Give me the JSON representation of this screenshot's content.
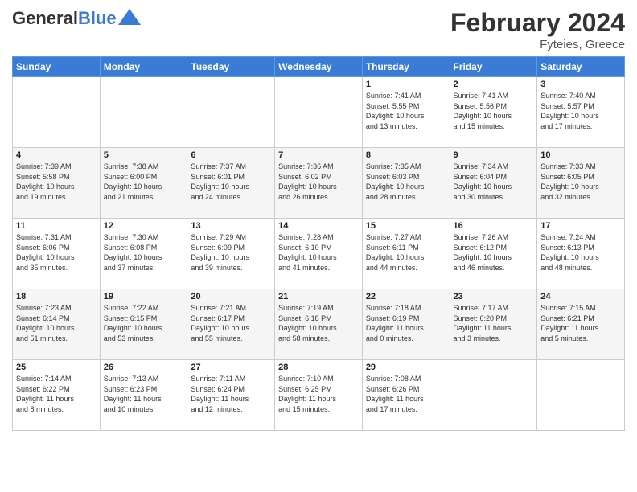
{
  "header": {
    "logo_general": "General",
    "logo_blue": "Blue",
    "title": "February 2024",
    "subtitle": "Fyteies, Greece"
  },
  "days_of_week": [
    "Sunday",
    "Monday",
    "Tuesday",
    "Wednesday",
    "Thursday",
    "Friday",
    "Saturday"
  ],
  "weeks": [
    [
      {
        "day": "",
        "info": ""
      },
      {
        "day": "",
        "info": ""
      },
      {
        "day": "",
        "info": ""
      },
      {
        "day": "",
        "info": ""
      },
      {
        "day": "1",
        "info": "Sunrise: 7:41 AM\nSunset: 5:55 PM\nDaylight: 10 hours\nand 13 minutes."
      },
      {
        "day": "2",
        "info": "Sunrise: 7:41 AM\nSunset: 5:56 PM\nDaylight: 10 hours\nand 15 minutes."
      },
      {
        "day": "3",
        "info": "Sunrise: 7:40 AM\nSunset: 5:57 PM\nDaylight: 10 hours\nand 17 minutes."
      }
    ],
    [
      {
        "day": "4",
        "info": "Sunrise: 7:39 AM\nSunset: 5:58 PM\nDaylight: 10 hours\nand 19 minutes."
      },
      {
        "day": "5",
        "info": "Sunrise: 7:38 AM\nSunset: 6:00 PM\nDaylight: 10 hours\nand 21 minutes."
      },
      {
        "day": "6",
        "info": "Sunrise: 7:37 AM\nSunset: 6:01 PM\nDaylight: 10 hours\nand 24 minutes."
      },
      {
        "day": "7",
        "info": "Sunrise: 7:36 AM\nSunset: 6:02 PM\nDaylight: 10 hours\nand 26 minutes."
      },
      {
        "day": "8",
        "info": "Sunrise: 7:35 AM\nSunset: 6:03 PM\nDaylight: 10 hours\nand 28 minutes."
      },
      {
        "day": "9",
        "info": "Sunrise: 7:34 AM\nSunset: 6:04 PM\nDaylight: 10 hours\nand 30 minutes."
      },
      {
        "day": "10",
        "info": "Sunrise: 7:33 AM\nSunset: 6:05 PM\nDaylight: 10 hours\nand 32 minutes."
      }
    ],
    [
      {
        "day": "11",
        "info": "Sunrise: 7:31 AM\nSunset: 6:06 PM\nDaylight: 10 hours\nand 35 minutes."
      },
      {
        "day": "12",
        "info": "Sunrise: 7:30 AM\nSunset: 6:08 PM\nDaylight: 10 hours\nand 37 minutes."
      },
      {
        "day": "13",
        "info": "Sunrise: 7:29 AM\nSunset: 6:09 PM\nDaylight: 10 hours\nand 39 minutes."
      },
      {
        "day": "14",
        "info": "Sunrise: 7:28 AM\nSunset: 6:10 PM\nDaylight: 10 hours\nand 41 minutes."
      },
      {
        "day": "15",
        "info": "Sunrise: 7:27 AM\nSunset: 6:11 PM\nDaylight: 10 hours\nand 44 minutes."
      },
      {
        "day": "16",
        "info": "Sunrise: 7:26 AM\nSunset: 6:12 PM\nDaylight: 10 hours\nand 46 minutes."
      },
      {
        "day": "17",
        "info": "Sunrise: 7:24 AM\nSunset: 6:13 PM\nDaylight: 10 hours\nand 48 minutes."
      }
    ],
    [
      {
        "day": "18",
        "info": "Sunrise: 7:23 AM\nSunset: 6:14 PM\nDaylight: 10 hours\nand 51 minutes."
      },
      {
        "day": "19",
        "info": "Sunrise: 7:22 AM\nSunset: 6:15 PM\nDaylight: 10 hours\nand 53 minutes."
      },
      {
        "day": "20",
        "info": "Sunrise: 7:21 AM\nSunset: 6:17 PM\nDaylight: 10 hours\nand 55 minutes."
      },
      {
        "day": "21",
        "info": "Sunrise: 7:19 AM\nSunset: 6:18 PM\nDaylight: 10 hours\nand 58 minutes."
      },
      {
        "day": "22",
        "info": "Sunrise: 7:18 AM\nSunset: 6:19 PM\nDaylight: 11 hours\nand 0 minutes."
      },
      {
        "day": "23",
        "info": "Sunrise: 7:17 AM\nSunset: 6:20 PM\nDaylight: 11 hours\nand 3 minutes."
      },
      {
        "day": "24",
        "info": "Sunrise: 7:15 AM\nSunset: 6:21 PM\nDaylight: 11 hours\nand 5 minutes."
      }
    ],
    [
      {
        "day": "25",
        "info": "Sunrise: 7:14 AM\nSunset: 6:22 PM\nDaylight: 11 hours\nand 8 minutes."
      },
      {
        "day": "26",
        "info": "Sunrise: 7:13 AM\nSunset: 6:23 PM\nDaylight: 11 hours\nand 10 minutes."
      },
      {
        "day": "27",
        "info": "Sunrise: 7:11 AM\nSunset: 6:24 PM\nDaylight: 11 hours\nand 12 minutes."
      },
      {
        "day": "28",
        "info": "Sunrise: 7:10 AM\nSunset: 6:25 PM\nDaylight: 11 hours\nand 15 minutes."
      },
      {
        "day": "29",
        "info": "Sunrise: 7:08 AM\nSunset: 6:26 PM\nDaylight: 11 hours\nand 17 minutes."
      },
      {
        "day": "",
        "info": ""
      },
      {
        "day": "",
        "info": ""
      }
    ]
  ]
}
